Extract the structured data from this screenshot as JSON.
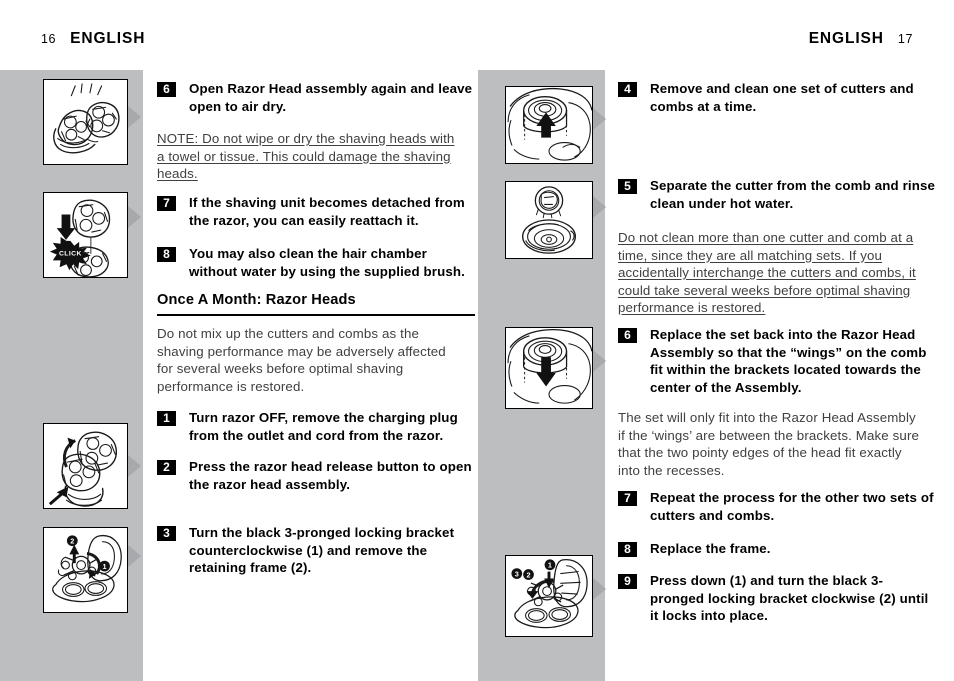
{
  "header": {
    "left_folio": "16",
    "left_title": "ENGLISH",
    "right_title": "ENGLISH",
    "right_folio": "17"
  },
  "colors": {
    "band_gray": "#bcbec0",
    "pointer_gray": "#a7a9ac",
    "text_black": "#000000",
    "body_gray": "#404040"
  },
  "left_column": {
    "steps": [
      {
        "num": "6",
        "text": "Open Razor Head assembly again and leave open to air dry."
      },
      {
        "num": "7",
        "text": "If the shaving unit becomes detached from the razor, you can easily reattach it."
      },
      {
        "num": "8",
        "text": "You may also clean the hair chamber without water by using the supplied brush."
      },
      {
        "num": "1",
        "text": "Turn razor OFF, remove the charging plug from the outlet and cord from the razor."
      },
      {
        "num": "2",
        "text": "Press the razor head release button to open the razor head assembly."
      },
      {
        "num": "3",
        "text": "Turn the black 3-pronged locking bracket counterclockwise (1) and remove the retaining frame (2)."
      }
    ],
    "note": "NOTE: Do not wipe or dry the shaving heads with a towel or tissue. This could damage the shaving heads.",
    "section_heading": "Once A Month:  Razor Heads",
    "section_paragraph": "Do not mix up the cutters and combs as the shaving performance may be adversely affected for several weeks before optimal shaving performance is restored."
  },
  "right_column": {
    "steps": [
      {
        "num": "4",
        "text": "Remove and clean one set of cutters and combs at a time."
      },
      {
        "num": "5",
        "text": "Separate the cutter from the comb and rinse clean under hot water."
      },
      {
        "num": "6",
        "text": "Replace the set back into the Razor Head Assembly so that the “wings” on the comb fit within the brackets located towards the center of the Assembly."
      },
      {
        "num": "7",
        "text": "Repeat the process for the other two sets of cutters and combs."
      },
      {
        "num": "8",
        "text": "Replace the frame."
      },
      {
        "num": "9",
        "text": "Press down (1) and turn the black 3-pronged locking bracket clockwise (2) until it locks into place."
      }
    ],
    "note": "Do not clean more than one cutter and comb at a time, since they are all matching sets. If you accidentally interchange the cutters and combs, it could take several weeks before optimal shaving performance is restored.",
    "paragraph": "The set will only fit into the Razor Head Assembly if the ‘wings’ are between the brackets. Make sure that the two pointy edges of the head fit exactly into the recesses."
  },
  "figures": {
    "left": [
      {
        "name": "razor-head-open-air-dry-figure",
        "caption_ref": "6",
        "label": ""
      },
      {
        "name": "shaving-unit-reattach-click-figure",
        "caption_ref": "7",
        "label": "CLICK"
      },
      {
        "name": "open-razor-head-assembly-figure",
        "caption_ref": "2",
        "label": ""
      },
      {
        "name": "locking-bracket-counterclockwise-figure",
        "caption_ref": "3",
        "marks": [
          "1",
          "2"
        ]
      }
    ],
    "right": [
      {
        "name": "remove-cutter-comb-set-figure",
        "caption_ref": "4",
        "label": ""
      },
      {
        "name": "separate-cutter-from-comb-figure",
        "caption_ref": "5",
        "label": ""
      },
      {
        "name": "replace-cutter-comb-set-figure",
        "caption_ref": "6",
        "label": ""
      },
      {
        "name": "locking-bracket-clockwise-figure",
        "caption_ref": "9",
        "marks": [
          "1",
          "2"
        ]
      }
    ]
  }
}
